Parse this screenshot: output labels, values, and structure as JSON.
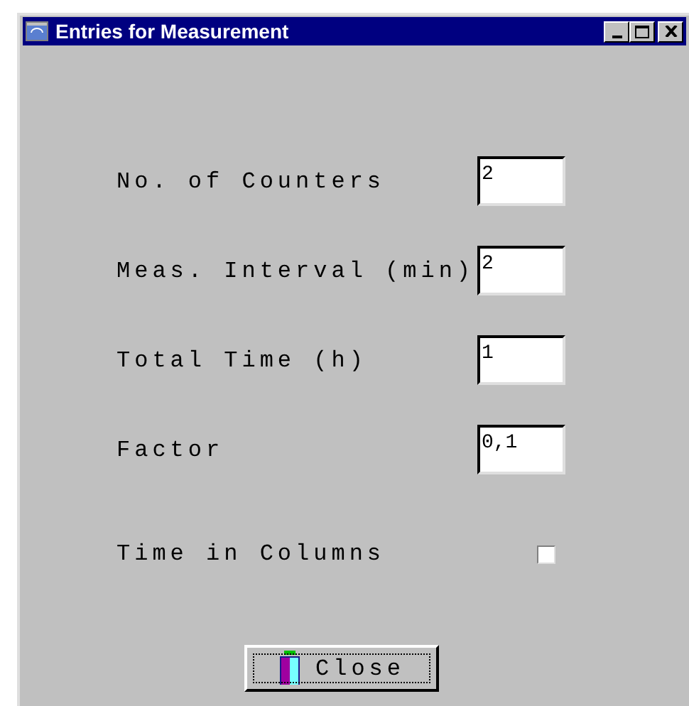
{
  "window": {
    "title": "Entries for Measurement"
  },
  "fields": [
    {
      "label": "No. of Counters",
      "value": "2"
    },
    {
      "label": "Meas. Interval (min)",
      "value": "2"
    },
    {
      "label": "Total Time (h)",
      "value": "1"
    },
    {
      "label": "Factor",
      "value": "0,1"
    }
  ],
  "checkbox": {
    "label": "Time in Columns",
    "checked": false
  },
  "close_button": {
    "label": "Close"
  }
}
